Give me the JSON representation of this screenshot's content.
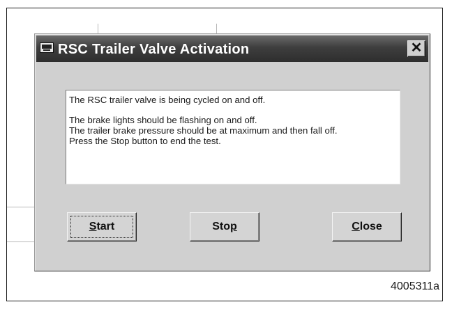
{
  "dialog": {
    "title": "RSC Trailer Valve Activation",
    "close_glyph": "✕",
    "message": {
      "line1": "The RSC trailer valve is being cycled on and off.",
      "line2": "The brake lights should be flashing on and off.",
      "line3": "The trailer brake pressure should be at maximum and then fall off.",
      "line4": "Press the Stop button to end the test."
    },
    "buttons": {
      "start": {
        "hotkey": "S",
        "rest": "tart"
      },
      "stop": {
        "lead": "Sto",
        "hotkey": "p"
      },
      "close": {
        "hotkey": "C",
        "rest": "lose"
      }
    }
  },
  "figure_id": "4005311a",
  "icons": {
    "title_icon": "computer-icon"
  }
}
